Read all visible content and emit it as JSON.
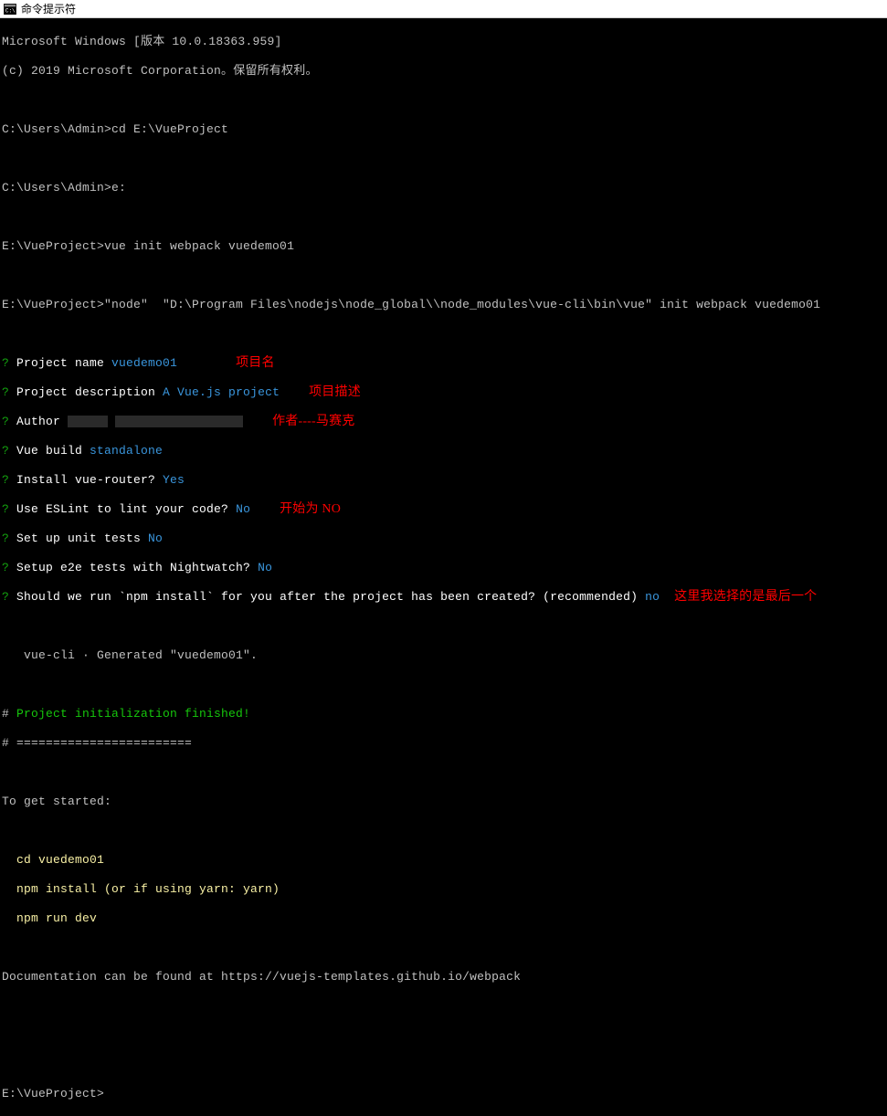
{
  "titlebar": {
    "title": "命令提示符"
  },
  "header": {
    "version_line": "Microsoft Windows [版本 10.0.18363.959]",
    "copyright": "(c) 2019 Microsoft Corporation。保留所有权利。"
  },
  "prompts": {
    "p1_path": "C:\\Users\\Admin>",
    "p1_cmd": "cd E:\\VueProject",
    "p2_path": "C:\\Users\\Admin>",
    "p2_cmd": "e:",
    "p3_path": "E:\\VueProject>",
    "p3_cmd": "vue init webpack vuedemo01",
    "p4_path": "E:\\VueProject>",
    "p4_cmd": "\"node\"  \"D:\\Program Files\\nodejs\\node_global\\\\node_modules\\vue-cli\\bin\\vue\" init webpack vuedemo01",
    "p5_path": "E:\\VueProject>"
  },
  "questions": {
    "q_mark": "?",
    "name_label": " Project name ",
    "name_val": "vuedemo01",
    "desc_label": " Project description ",
    "desc_val": "A Vue.js project",
    "author_label": " Author ",
    "build_label": " Vue build ",
    "build_val": "standalone",
    "router_label": " Install vue-router? ",
    "router_val": "Yes",
    "eslint_label": " Use ESLint to lint your code? ",
    "eslint_val": "No",
    "unit_label": " Set up unit tests ",
    "unit_val": "No",
    "e2e_label": " Setup e2e tests with Nightwatch? ",
    "e2e_val": "No",
    "npm_label": " Should we run `npm install` for you after the project has been created? (recommended) ",
    "npm_val": "no"
  },
  "annotations": {
    "proj_name": "项目名",
    "proj_desc": "项目描述",
    "author": "作者----马赛克",
    "start_no": "开始为 NO",
    "last_choice": "这里我选择的是最后一个"
  },
  "generated": {
    "line": "   vue-cli · Generated \"vuedemo01\"."
  },
  "finish": {
    "hash": "#",
    "msg": " Project initialization finished!",
    "divider": " ========================"
  },
  "started": {
    "header": "To get started:",
    "cd": "  cd vuedemo01",
    "install": "  npm install (or if using yarn: yarn)",
    "dev": "  npm run dev"
  },
  "docs": {
    "line": "Documentation can be found at https://vuejs-templates.github.io/webpack"
  }
}
